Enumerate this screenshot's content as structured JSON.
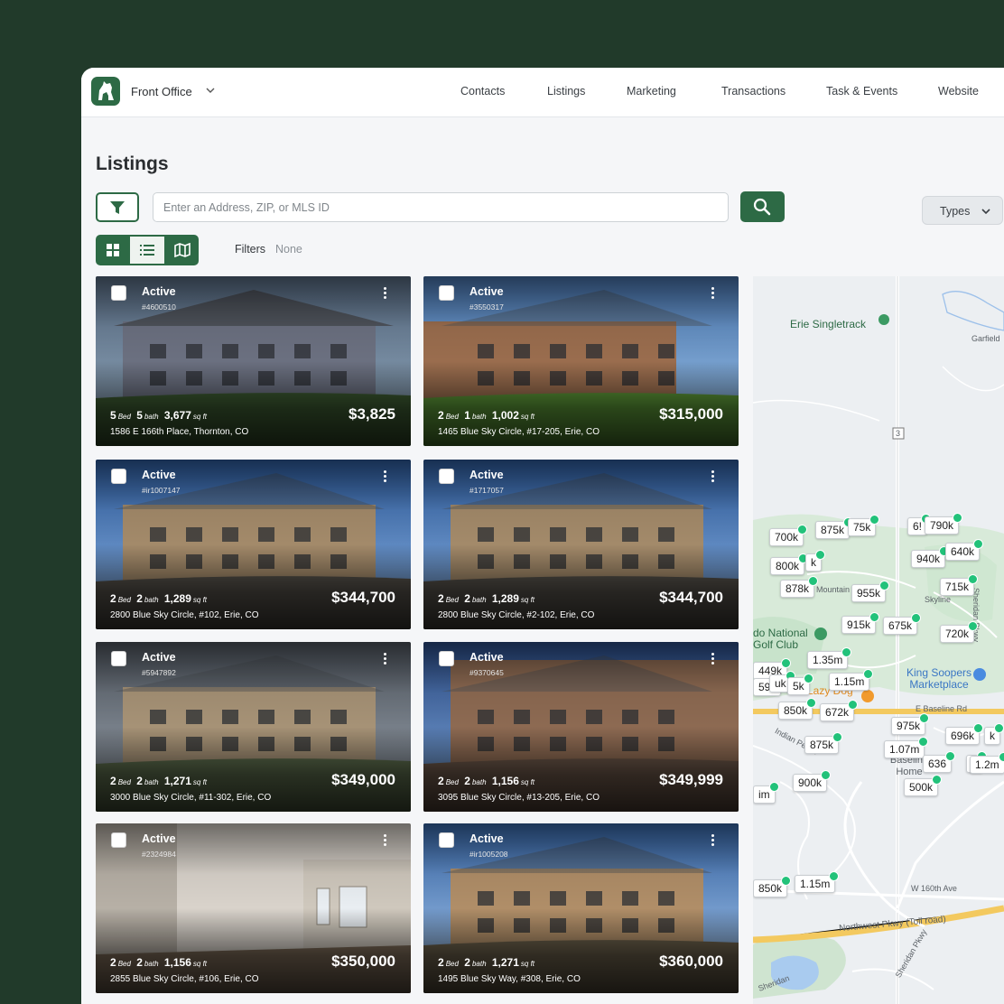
{
  "app": {
    "name": "Front Office"
  },
  "nav": [
    "Contacts",
    "Listings",
    "Marketing",
    "Transactions",
    "Task & Events",
    "Website"
  ],
  "page": {
    "title": "Listings"
  },
  "search": {
    "placeholder": "Enter an Address, ZIP, or MLS ID",
    "value": ""
  },
  "types_label": "Types",
  "filters": {
    "label": "Filters",
    "value": "None"
  },
  "colors": {
    "brand": "#2d6a45",
    "background": "#213a2a",
    "pin_dot": "#22c27a"
  },
  "icons": [
    "logo-icon",
    "chevron-down-icon",
    "filter-icon",
    "search-icon",
    "grid-view-icon",
    "list-view-icon",
    "map-view-icon",
    "kebab-menu-icon"
  ],
  "listings": [
    {
      "status": "Active",
      "mls": "#4600510",
      "beds": "5",
      "baths": "5",
      "sqft": "3,677",
      "price": "$3,825",
      "address": "1586 E 166th Place, Thornton, CO"
    },
    {
      "status": "Active",
      "mls": "#3550317",
      "beds": "2",
      "baths": "1",
      "sqft": "1,002",
      "price": "$315,000",
      "address": "1465 Blue Sky Circle, #17-205, Erie, CO"
    },
    {
      "status": "Active",
      "mls": "#ir1007147",
      "beds": "2",
      "baths": "2",
      "sqft": "1,289",
      "price": "$344,700",
      "address": "2800 Blue Sky Circle, #102, Erie, CO"
    },
    {
      "status": "Active",
      "mls": "#1717057",
      "beds": "2",
      "baths": "2",
      "sqft": "1,289",
      "price": "$344,700",
      "address": "2800 Blue Sky Circle, #2-102, Erie, CO"
    },
    {
      "status": "Active",
      "mls": "#5947892",
      "beds": "2",
      "baths": "2",
      "sqft": "1,271",
      "price": "$349,000",
      "address": "3000 Blue Sky Circle, #11-302, Erie, CO"
    },
    {
      "status": "Active",
      "mls": "#9370645",
      "beds": "2",
      "baths": "2",
      "sqft": "1,156",
      "price": "$349,999",
      "address": "3095 Blue Sky Circle, #13-205, Erie, CO"
    },
    {
      "status": "Active",
      "mls": "#2324984",
      "beds": "2",
      "baths": "2",
      "sqft": "1,156",
      "price": "$350,000",
      "address": "2855 Blue Sky Circle, #106, Erie, CO"
    },
    {
      "status": "Active",
      "mls": "#ir1005208",
      "beds": "2",
      "baths": "2",
      "sqft": "1,271",
      "price": "$360,000",
      "address": "1495 Blue Sky Way, #308, Erie, CO"
    }
  ],
  "spec_units": {
    "bed": "Bed",
    "bath": "bath",
    "sqft": "sq ft"
  },
  "map": {
    "labels": [
      "Erie Singletrack",
      "Garfield",
      "3",
      "Mountain",
      "Skyline",
      "Sheridan Pkwy",
      "do National Golf Club",
      "King Soopers Marketplace",
      "Lazy Dog",
      "E Baseline Rd",
      "Indian Peaks",
      "Baseline Home",
      "W 160th Ave",
      "Northwest Pkwy (Toll road)",
      "Sheridan Pkwy",
      "Sheridan"
    ],
    "price_pins": [
      "700k",
      "875k",
      "75k",
      "6!",
      "790k",
      "940k",
      "640k",
      "800k",
      "k",
      "878k",
      "955k",
      "715k",
      "915k",
      "675k",
      "720k",
      "1.35m",
      "449k",
      "59k",
      "uk",
      "5k",
      "1.15m",
      "850k",
      "672k",
      "975k",
      "696k",
      "k",
      "875k",
      "1.07m",
      "636",
      "7",
      "1.2m",
      "900k",
      "500k",
      "im",
      "850k",
      "1.15m"
    ]
  }
}
